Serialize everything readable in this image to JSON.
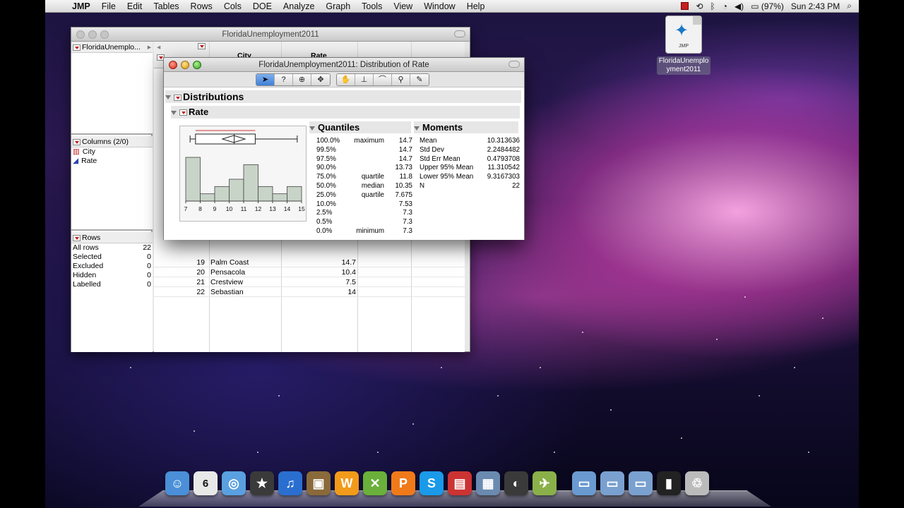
{
  "menubar": {
    "app": "JMP",
    "items": [
      "File",
      "Edit",
      "Tables",
      "Rows",
      "Cols",
      "DOE",
      "Analyze",
      "Graph",
      "Tools",
      "View",
      "Window",
      "Help"
    ],
    "battery": "(97%)",
    "clock": "Sun 2:43 PM"
  },
  "desktop_icon": {
    "label": "FloridaUnemployment2011",
    "badge": "JMP"
  },
  "table_window": {
    "title": "FloridaUnemployment2011",
    "table_panel": "FloridaUnemplo...",
    "columns_panel": {
      "title": "Columns (2/0)",
      "items": [
        "City",
        "Rate"
      ]
    },
    "rows_panel": {
      "title": "Rows",
      "items": [
        {
          "label": "All rows",
          "value": "22"
        },
        {
          "label": "Selected",
          "value": "0"
        },
        {
          "label": "Excluded",
          "value": "0"
        },
        {
          "label": "Hidden",
          "value": "0"
        },
        {
          "label": "Labelled",
          "value": "0"
        }
      ]
    },
    "headers": {
      "city": "City",
      "rate": "Rate"
    },
    "rows": [
      {
        "num": "19",
        "city": "Palm Coast",
        "rate": "14.7"
      },
      {
        "num": "20",
        "city": "Pensacola",
        "rate": "10.4"
      },
      {
        "num": "21",
        "city": "Crestview",
        "rate": "7.5"
      },
      {
        "num": "22",
        "city": "Sebastian",
        "rate": "14"
      }
    ]
  },
  "dist_window": {
    "title": "FloridaUnemployment2011: Distribution of Rate",
    "toolbar_icons": [
      "arrow-icon",
      "help-icon",
      "crosshair-icon",
      "move-icon",
      "hand-icon",
      "brush-icon",
      "lasso-icon",
      "magnifier-icon",
      "annotate-icon"
    ],
    "distributions_label": "Distributions",
    "rate_label": "Rate",
    "quantiles_title": "Quantiles",
    "quantiles": [
      {
        "pct": "100.0%",
        "label": "maximum",
        "value": "14.7"
      },
      {
        "pct": "99.5%",
        "label": "",
        "value": "14.7"
      },
      {
        "pct": "97.5%",
        "label": "",
        "value": "14.7"
      },
      {
        "pct": "90.0%",
        "label": "",
        "value": "13.73"
      },
      {
        "pct": "75.0%",
        "label": "quartile",
        "value": "11.8"
      },
      {
        "pct": "50.0%",
        "label": "median",
        "value": "10.35"
      },
      {
        "pct": "25.0%",
        "label": "quartile",
        "value": "7.675"
      },
      {
        "pct": "10.0%",
        "label": "",
        "value": "7.53"
      },
      {
        "pct": "2.5%",
        "label": "",
        "value": "7.3"
      },
      {
        "pct": "0.5%",
        "label": "",
        "value": "7.3"
      },
      {
        "pct": "0.0%",
        "label": "minimum",
        "value": "7.3"
      }
    ],
    "moments_title": "Moments",
    "moments": [
      {
        "label": "Mean",
        "value": "10.313636"
      },
      {
        "label": "Std Dev",
        "value": "2.2484482"
      },
      {
        "label": "Std Err Mean",
        "value": "0.4793708"
      },
      {
        "label": "Upper 95% Mean",
        "value": "11.310542"
      },
      {
        "label": "Lower 95% Mean",
        "value": "9.3167303"
      },
      {
        "label": "N",
        "value": "22"
      }
    ],
    "histogram": {
      "bins": [
        7,
        8,
        9,
        10,
        11,
        12,
        13,
        14,
        15
      ],
      "counts": [
        6,
        1,
        2,
        3,
        5,
        2,
        1,
        2
      ],
      "tick_labels": [
        "7",
        "8",
        "9",
        "10",
        "11",
        "12",
        "13",
        "14",
        "15"
      ]
    }
  },
  "dock": {
    "icons": [
      "finder-icon",
      "ical-icon",
      "safari-icon",
      "imovie-icon",
      "itunes-icon",
      "iphoto-icon",
      "wu-icon",
      "xmind-icon",
      "pages-icon",
      "skype-icon",
      "photobooth-icon",
      "preview-icon",
      "dashboard-icon",
      "maps-icon",
      "folder-icon",
      "documents-icon",
      "downloads-icon",
      "terminal-icon",
      "trash-icon"
    ],
    "ical_day": "6"
  }
}
